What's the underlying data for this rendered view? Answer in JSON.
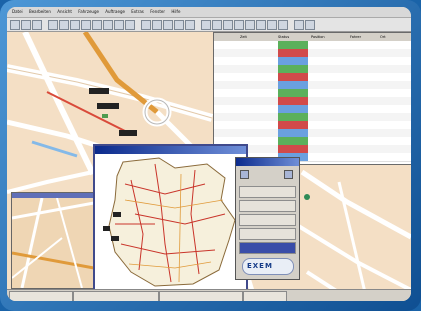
{
  "window": {
    "menubar_items": [
      "Datei",
      "Bearbeiten",
      "Ansicht",
      "Fahrzeuge",
      "Auftraege",
      "Extras",
      "Fenster",
      "Hilfe"
    ]
  },
  "table": {
    "headers": [
      "",
      "Zeit",
      "Status",
      "Position",
      "Fahrer",
      "Ort"
    ],
    "rows": [
      [
        "",
        "",
        "",
        "",
        "",
        ""
      ],
      [
        "",
        "",
        "",
        "",
        "",
        ""
      ],
      [
        "",
        "",
        "",
        "",
        "",
        ""
      ],
      [
        "",
        "",
        "",
        "",
        "",
        ""
      ],
      [
        "",
        "",
        "",
        "",
        "",
        ""
      ],
      [
        "",
        "",
        "",
        "",
        "",
        ""
      ],
      [
        "",
        "",
        "",
        "",
        "",
        ""
      ],
      [
        "",
        "",
        "",
        "",
        "",
        ""
      ],
      [
        "",
        "",
        "",
        "",
        "",
        ""
      ],
      [
        "",
        "",
        "",
        "",
        "",
        ""
      ],
      [
        "",
        "",
        "",
        "",
        "",
        ""
      ],
      [
        "",
        "",
        "",
        "",
        "",
        ""
      ],
      [
        "",
        "",
        "",
        "",
        "",
        ""
      ],
      [
        "",
        "",
        "",
        "",
        "",
        ""
      ],
      [
        "",
        "",
        "",
        "",
        "",
        ""
      ]
    ],
    "status_colors": [
      "#5bb05b",
      "#d14a4a",
      "#6aa0e0"
    ]
  },
  "panel": {
    "buttons": [
      "",
      "",
      "",
      ""
    ],
    "logo": "EXEM"
  },
  "statusbar": {
    "segments": [
      "",
      "",
      "",
      ""
    ]
  },
  "colors": {
    "road_major": "#e09a3a",
    "road_minor": "#ffffff",
    "river": "#84b9e8",
    "vehicle": "#222222",
    "accent_blue": "#1f62b7"
  }
}
